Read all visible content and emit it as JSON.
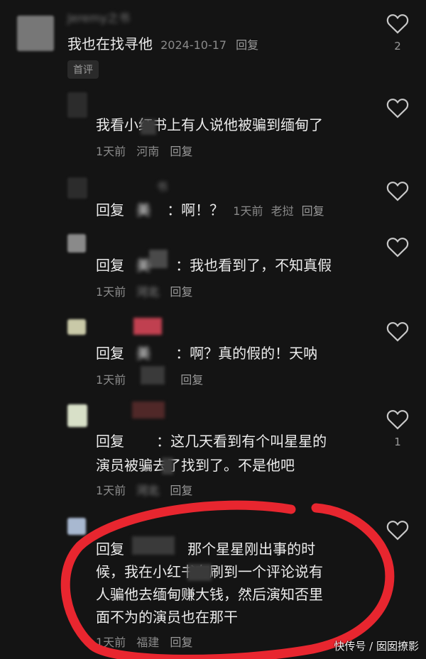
{
  "main_comment": {
    "author": "Jeremy之书",
    "text": "我也在找寻他",
    "date": "2024-10-17",
    "reply_label": "回复",
    "tag": "首评",
    "likes": "2"
  },
  "replies": [
    {
      "author": "",
      "text": "我看小红书上有人说他被骗到缅甸了",
      "time": "1天前",
      "location": "河南",
      "reply_label": "回复",
      "likes": ""
    },
    {
      "author": "书",
      "prefix": "回复",
      "target": "美",
      "text": "：啊！？",
      "time": "1天前",
      "location": "老挝",
      "reply_label": "回复",
      "likes": ""
    },
    {
      "author": "",
      "prefix": "回复",
      "target": "美",
      "text": "：我也看到了，不知真假",
      "time": "1天前",
      "location": "河北",
      "reply_label": "回复",
      "likes": ""
    },
    {
      "author": "",
      "prefix": "回复",
      "target": "美",
      "text": "：啊？真的假的！天呐",
      "time": "1天前",
      "location": "",
      "reply_label": "回复",
      "likes": ""
    },
    {
      "author": "",
      "prefix": "回复",
      "target": "",
      "text_line1": "：这几天看到有个叫星星的",
      "text_line2": "演员被骗去了找到了。不是他吧",
      "time": "1天前",
      "location": "河北",
      "reply_label": "回复",
      "likes": "1"
    },
    {
      "author": "",
      "prefix": "回复",
      "target": "",
      "text_line1": "那个星星刚出事的时",
      "text_line2": "候，我在小红书有刷到一个评论说有",
      "text_line3": "人骗他去缅甸赚大钱，然后演知否里",
      "text_line4": "面不为的演员也在那干",
      "time": "1天前",
      "location": "福建",
      "reply_label": "回复",
      "likes": ""
    }
  ],
  "watermark": "快传号 / 囡囡撩影",
  "colors": {
    "background": "#141414",
    "annotation_circle": "#e8262f"
  },
  "icons": {
    "like": "heart-outline-icon"
  }
}
